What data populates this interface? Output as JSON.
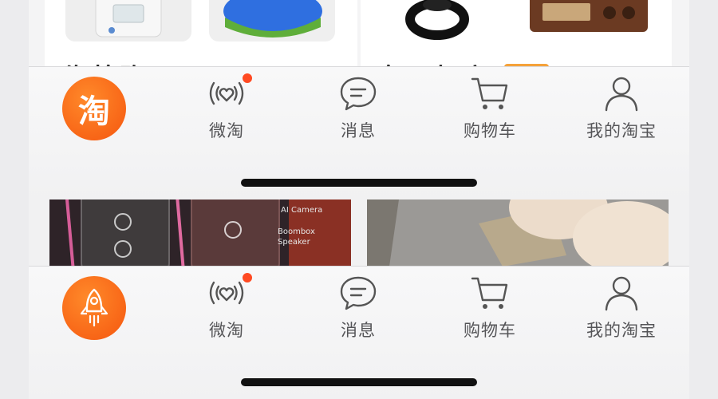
{
  "feed_top": {
    "left_title": "淘抢购",
    "right_title": "每日好店"
  },
  "tabbar_taobao": {
    "home_glyph": "淘",
    "tabs": [
      {
        "label": "微淘",
        "icon": "heart-broadcast-icon",
        "has_badge": true
      },
      {
        "label": "消息",
        "icon": "chat-bubble-icon",
        "has_badge": false
      },
      {
        "label": "购物车",
        "icon": "shopping-cart-icon",
        "has_badge": false
      },
      {
        "label": "我的淘宝",
        "icon": "user-icon",
        "has_badge": false
      }
    ]
  },
  "tabbar_rocket": {
    "home_icon": "rocket-icon",
    "tabs": [
      {
        "label": "微淘",
        "icon": "heart-broadcast-icon",
        "has_badge": true
      },
      {
        "label": "消息",
        "icon": "chat-bubble-icon",
        "has_badge": false
      },
      {
        "label": "购物车",
        "icon": "shopping-cart-icon",
        "has_badge": false
      },
      {
        "label": "我的淘宝",
        "icon": "user-icon",
        "has_badge": false
      }
    ]
  },
  "product_images": {
    "speaker_text_1": "AI Camera",
    "speaker_text_2": "Boombox Speaker"
  },
  "colors": {
    "accent": "#f5560f",
    "badge": "#ff4a22",
    "label": "#555558"
  }
}
